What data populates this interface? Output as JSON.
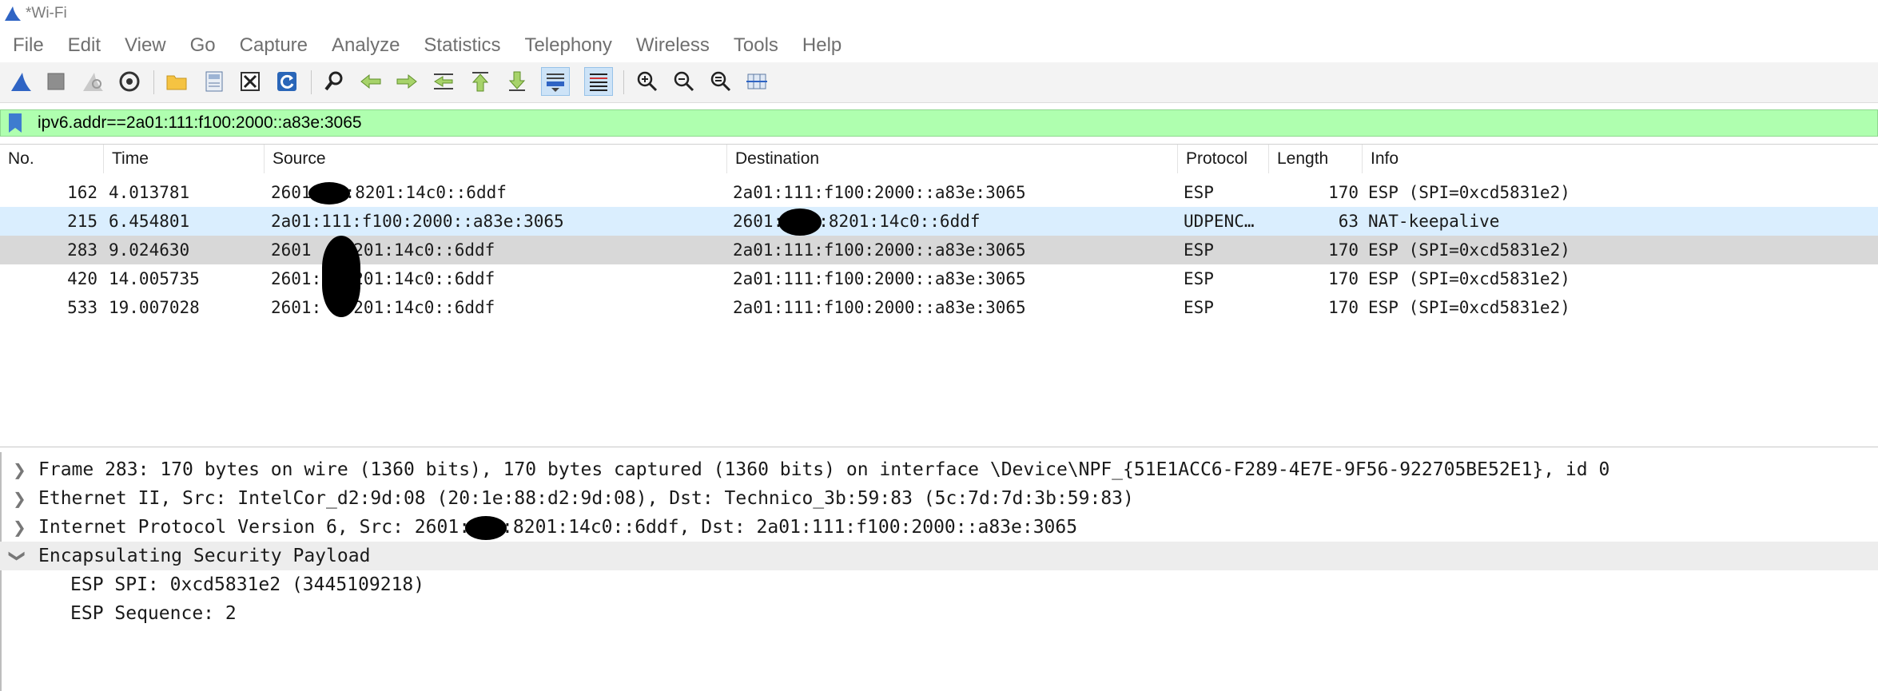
{
  "window": {
    "title": "*Wi-Fi"
  },
  "menu": [
    "File",
    "Edit",
    "View",
    "Go",
    "Capture",
    "Analyze",
    "Statistics",
    "Telephony",
    "Wireless",
    "Tools",
    "Help"
  ],
  "toolbar": {
    "icons": [
      "start-capture-icon",
      "stop-capture-icon",
      "restart-capture-icon",
      "capture-options-icon",
      "open-file-icon",
      "save-file-icon",
      "close-file-icon",
      "reload-file-icon",
      "find-packet-icon",
      "go-back-icon",
      "go-forward-icon",
      "go-to-packet-icon",
      "go-first-icon",
      "go-last-icon",
      "auto-scroll-icon",
      "colorize-icon",
      "zoom-in-icon",
      "zoom-out-icon",
      "normal-size-icon",
      "resize-columns-icon"
    ],
    "accent": "#3a66c4"
  },
  "filter": {
    "value": "ipv6.addr==2a01:111:f100:2000::a83e:3065",
    "bg": "#afffaf"
  },
  "packet_list": {
    "columns": [
      "No.",
      "Time",
      "Source",
      "Destination",
      "Protocol",
      "Length",
      "Info"
    ],
    "rows": [
      {
        "no": "162",
        "time": "4.013781",
        "src_pre": "2601",
        "src_post": ":8201:14c0::6ddf",
        "dst": "2a01:111:f100:2000::a83e:3065",
        "proto": "ESP",
        "len": "170",
        "info": "ESP (SPI=0xcd5831e2)"
      },
      {
        "no": "215",
        "time": "6.454801",
        "src": "2a01:111:f100:2000::a83e:3065",
        "dst_pre": "2601:",
        "dst_post": ":8201:14c0::6ddf",
        "proto": "UDPENC…",
        "len": "63",
        "info": "NAT-keepalive"
      },
      {
        "no": "283",
        "time": "9.024630",
        "src_pre": "2601",
        "src_post": ":8201:14c0::6ddf",
        "dst": "2a01:111:f100:2000::a83e:3065",
        "proto": "ESP",
        "len": "170",
        "info": "ESP (SPI=0xcd5831e2)"
      },
      {
        "no": "420",
        "time": "14.005735",
        "src_pre": "2601:",
        "src_post": ":8201:14c0::6ddf",
        "dst": "2a01:111:f100:2000::a83e:3065",
        "proto": "ESP",
        "len": "170",
        "info": "ESP (SPI=0xcd5831e2)"
      },
      {
        "no": "533",
        "time": "19.007028",
        "src_pre": "2601:",
        "src_post": ":8201:14c0::6ddf",
        "dst": "2a01:111:f100:2000::a83e:3065",
        "proto": "ESP",
        "len": "170",
        "info": "ESP (SPI=0xcd5831e2)"
      }
    ]
  },
  "details": {
    "frame": "Frame 283: 170 bytes on wire (1360 bits), 170 bytes captured (1360 bits) on interface \\Device\\NPF_{51E1ACC6-F289-4E7E-9F56-922705BE52E1}, id 0",
    "ethernet": "Ethernet II, Src: IntelCor_d2:9d:08 (20:1e:88:d2:9d:08), Dst: Technico_3b:59:83 (5c:7d:7d:3b:59:83)",
    "ipv6_pre": "Internet Protocol Version 6, Src: 2601:",
    "ipv6_post": ":8201:14c0::6ddf, Dst: 2a01:111:f100:2000::a83e:3065",
    "esp": "Encapsulating Security Payload",
    "esp_spi": "ESP SPI: 0xcd5831e2 (3445109218)",
    "esp_seq": "ESP Sequence: 2"
  }
}
